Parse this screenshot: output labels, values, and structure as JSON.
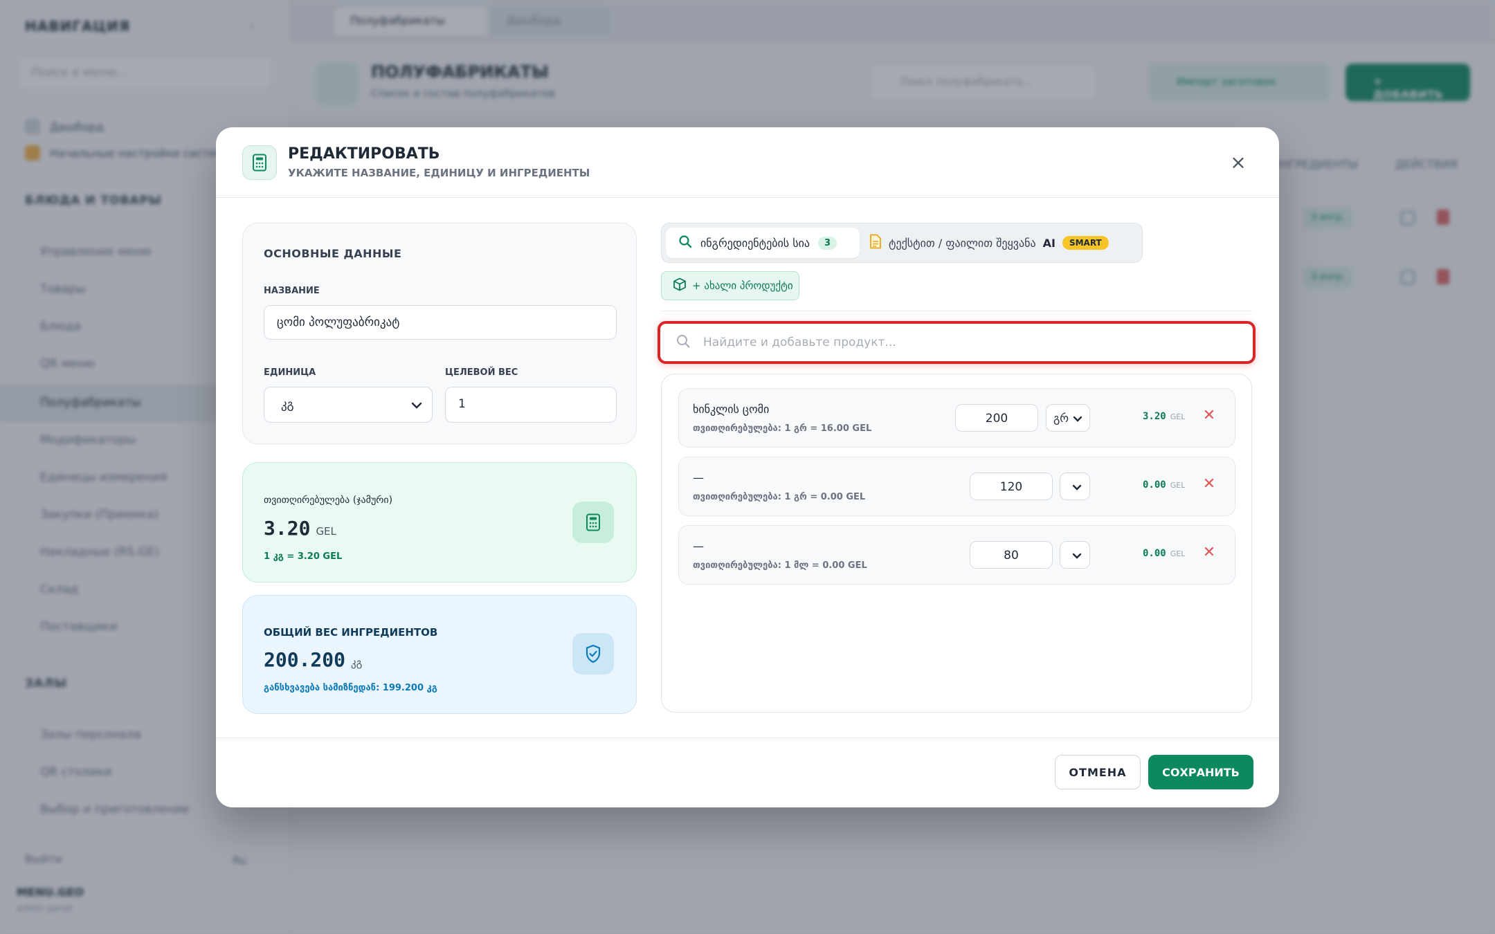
{
  "background": {
    "sidebar": {
      "title": "НАВИГАЦИЯ",
      "search_placeholder": "Поиск в меню...",
      "links": [
        "Дашборд",
        "Начальные настройки системы"
      ],
      "section1": "БЛЮДА И ТОВАРЫ",
      "items": [
        "Управление меню",
        "Товары",
        "Блюда",
        "QR меню",
        "Полуфабрикаты",
        "Модификаторы",
        "Единицы измерения",
        "Закупки (Приемка)",
        "Накладные (RS.GE)",
        "Склад",
        "Поставщики"
      ],
      "active_item": "Полуфабрикаты",
      "section2": "ЗАЛЫ",
      "section2_items": [
        "Залы персонала",
        "QR столики",
        "Выбор и приготовление"
      ],
      "logout": "Выйти",
      "language": "Ru",
      "user": "MENU.GEO",
      "user_sub": "admin panel"
    },
    "tabs": [
      "Полуфабрикаты",
      "Дашборд"
    ],
    "page_title": "ПОЛУФАБРИКАТЫ",
    "page_subtitle": "Список и состав полуфабрикатов",
    "search_placeholder": "Поиск полуфабриката...",
    "import_button": "Импорт заготовок",
    "add_button": "+ ДОБАВИТЬ",
    "columns": [
      "ИНГРЕДИЕНТЫ",
      "ДЕЙСТВИЯ"
    ],
    "rows": [
      {
        "badge": "3 ингр."
      },
      {
        "badge": "3 ингр."
      }
    ]
  },
  "modal": {
    "title": "РЕДАКТИРОВАТЬ",
    "subtitle": "УКАЖИТЕ НАЗВАНИЕ, ЕДИНИЦУ И ИНГРЕДИЕНТЫ",
    "basic": {
      "section_title": "ОСНОВНЫЕ ДАННЫЕ",
      "name_label": "НАЗВАНИЕ",
      "name_value": "ცომი პოლუფაბრიკატ",
      "unit_label": "ЕДИНИЦА",
      "unit_value": "კგ",
      "target_weight_label": "ЦЕЛЕВОЙ ВЕС",
      "target_weight_value": "1"
    },
    "cost": {
      "label": "თვითღირებულება (ჯამური)",
      "value": "3.20",
      "currency": "GEL",
      "rate": "1 კგ = 3.20 GEL"
    },
    "weight": {
      "label": "ОБЩИЙ ВЕС ИНГРЕДИЕНТОВ",
      "value": "200.200",
      "unit": "კგ",
      "diff": "განსხვავება სამიზნედან: 199.200 კგ"
    },
    "tabs": {
      "ingredients_label": "ინგრედიენტების სია",
      "ingredients_count": "3",
      "import_label": "ტექსტით / ფაილით შეყვანა",
      "ai_label": "AI",
      "smart_badge": "SMART"
    },
    "new_product_label": "+ ახალი პროდუქტი",
    "search_placeholder": "Найдите и добавьте продукт...",
    "ingredients": [
      {
        "name": "ხინკლის ცომი",
        "cost_line": "თვითღირებულება: 1 გრ = 16.00 GEL",
        "qty": "200",
        "unit": "გრ",
        "price": "3.20",
        "currency": "GEL"
      },
      {
        "name": "—",
        "cost_line": "თვითღირებულება: 1 გრ = 0.00 GEL",
        "qty": "120",
        "unit": "",
        "price": "0.00",
        "currency": "GEL"
      },
      {
        "name": "—",
        "cost_line": "თვითღირებულება: 1 მლ = 0.00 GEL",
        "qty": "80",
        "unit": "",
        "price": "0.00",
        "currency": "GEL"
      }
    ],
    "cancel_label": "ОТМЕНА",
    "save_label": "СОХРАНИТЬ"
  },
  "colors": {
    "brand_green": "#0c8a5d",
    "highlight_red": "#d72626",
    "smart_yellow": "#f6c427"
  }
}
